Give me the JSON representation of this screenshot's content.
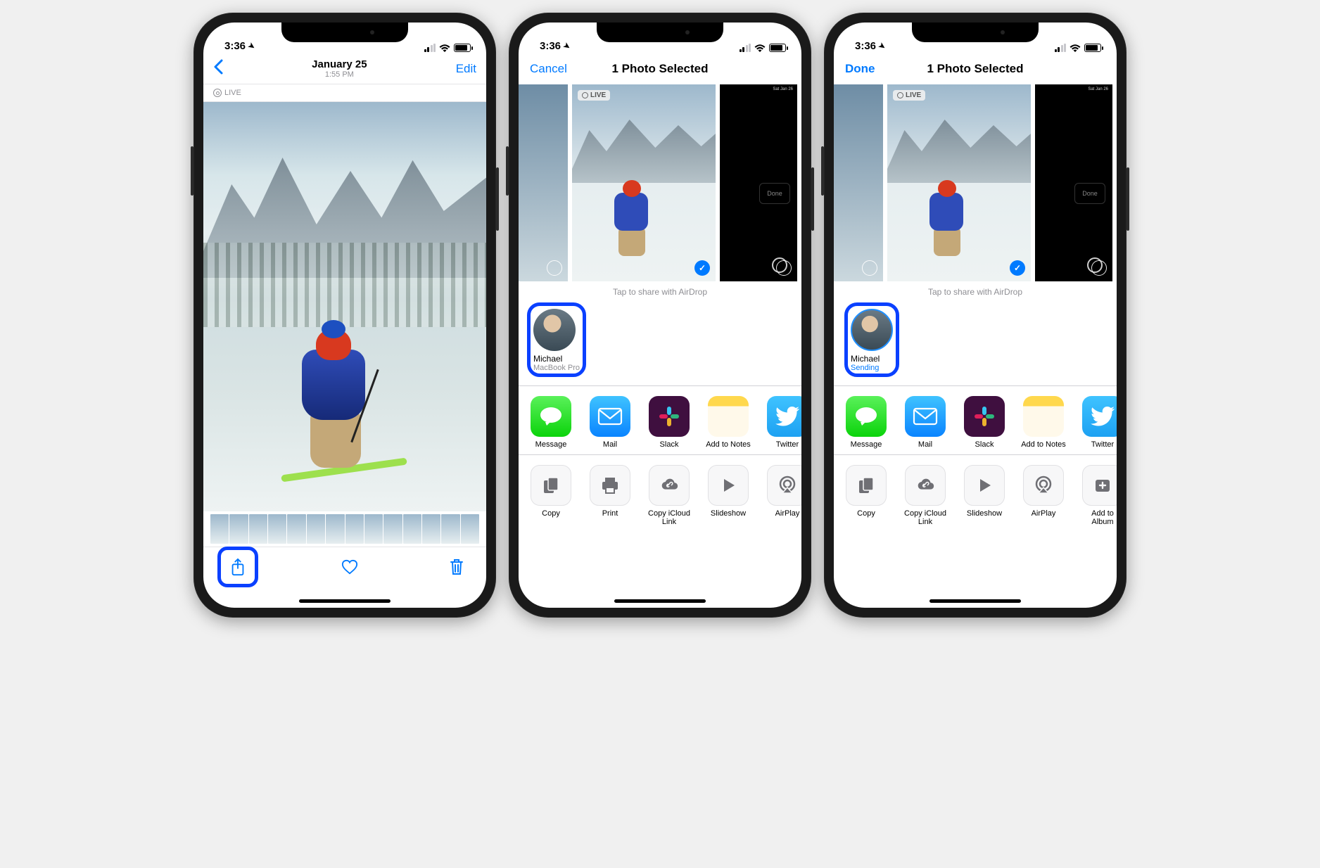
{
  "status": {
    "time": "3:36"
  },
  "screen1": {
    "nav": {
      "date": "January 25",
      "time": "1:55 PM",
      "edit": "Edit"
    },
    "live_badge": "LIVE"
  },
  "share": {
    "cancel": "Cancel",
    "done": "Done",
    "title": "1 Photo Selected",
    "live_badge": "LIVE",
    "airdrop_hint": "Tap to share with AirDrop",
    "contact": {
      "name": "Michael",
      "device": "MacBook Pro",
      "sending": "Sending"
    },
    "apps": [
      {
        "key": "message",
        "label": "Message"
      },
      {
        "key": "mail",
        "label": "Mail"
      },
      {
        "key": "slack",
        "label": "Slack"
      },
      {
        "key": "notes",
        "label": "Add to Notes"
      },
      {
        "key": "twitter",
        "label": "Twitter"
      }
    ],
    "actions_s2": [
      {
        "key": "copy",
        "label": "Copy"
      },
      {
        "key": "print",
        "label": "Print"
      },
      {
        "key": "icloud",
        "label": "Copy iCloud Link"
      },
      {
        "key": "slideshow",
        "label": "Slideshow"
      },
      {
        "key": "airplay",
        "label": "AirPlay"
      }
    ],
    "actions_s3": [
      {
        "key": "copy",
        "label": "Copy"
      },
      {
        "key": "icloud",
        "label": "Copy iCloud Link"
      },
      {
        "key": "slideshow",
        "label": "Slideshow"
      },
      {
        "key": "airplay",
        "label": "AirPlay"
      },
      {
        "key": "addalbum",
        "label": "Add to Album"
      }
    ],
    "dark_thumb": {
      "top_right": "Sat Jan 26",
      "done": "Done"
    }
  }
}
